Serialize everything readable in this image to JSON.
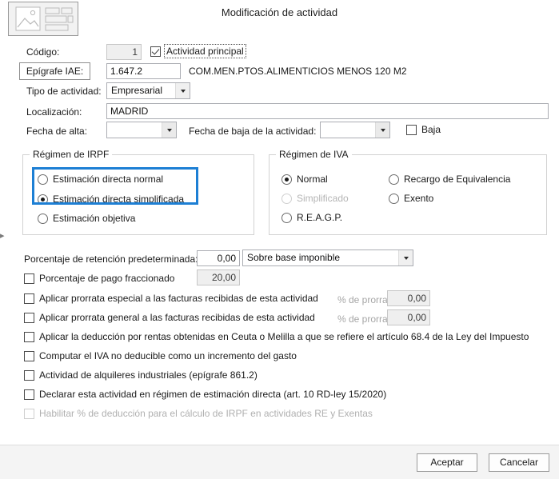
{
  "dialog": {
    "title": "Modificación de actividad",
    "icon": "image-placeholder-icon"
  },
  "form": {
    "codigo_label": "Código:",
    "codigo_value": "1",
    "actividad_principal_label": "Actividad principal",
    "actividad_principal_checked": true,
    "epigrafe_button": "Epígrafe IAE:",
    "epigrafe_value": "1.647.2",
    "epigrafe_description": "COM.MEN.PTOS.ALIMENTICIOS MENOS 120 M2",
    "tipo_actividad_label": "Tipo de actividad:",
    "tipo_actividad_value": "Empresarial",
    "localizacion_label": "Localización:",
    "localizacion_value": "MADRID",
    "fecha_alta_label": "Fecha de alta:",
    "fecha_alta_value": "",
    "fecha_baja_label": "Fecha de baja de la actividad:",
    "fecha_baja_value": "",
    "baja_label": "Baja",
    "baja_checked": false
  },
  "irpf": {
    "title": "Régimen de IRPF",
    "options": [
      {
        "label": "Estimación directa normal",
        "selected": false
      },
      {
        "label": "Estimación directa simplificada",
        "selected": true
      },
      {
        "label": "Estimación objetiva",
        "selected": false
      }
    ],
    "highlight_color": "#1d7fd4"
  },
  "iva": {
    "title": "Régimen de IVA",
    "options_left": [
      {
        "label": "Normal",
        "selected": true,
        "disabled": false
      },
      {
        "label": "Simplificado",
        "selected": false,
        "disabled": true
      },
      {
        "label": "R.E.A.G.P.",
        "selected": false,
        "disabled": false
      }
    ],
    "options_right": [
      {
        "label": "Recargo de Equivalencia",
        "selected": false,
        "disabled": false
      },
      {
        "label": "Exento",
        "selected": false,
        "disabled": false
      }
    ]
  },
  "retencion": {
    "label": "Porcentaje de retención predeterminada:",
    "value": "0,00",
    "base_option": "Sobre base imponible"
  },
  "pago_fraccionado": {
    "label": "Porcentaje de pago fraccionado",
    "checked": false,
    "value": "20,00"
  },
  "prorrata": {
    "percent_label": "% de prorrata:",
    "rows": [
      {
        "label": "Aplicar prorrata especial a las facturas recibidas de esta actividad",
        "checked": false,
        "value": "0,00"
      },
      {
        "label": "Aplicar prorrata general a las facturas recibidas de esta actividad",
        "checked": false,
        "value": "0,00"
      }
    ]
  },
  "checkboxes": [
    {
      "label": "Aplicar la deducción por rentas obtenidas en Ceuta o Melilla a que se refiere el artículo 68.4 de la Ley del Impuesto",
      "checked": false,
      "disabled": false
    },
    {
      "label": "Computar el IVA no deducible como un incremento del gasto",
      "checked": false,
      "disabled": false
    },
    {
      "label": "Actividad de alquileres industriales (epígrafe 861.2)",
      "checked": false,
      "disabled": false
    },
    {
      "label": "Declarar esta actividad en régimen de estimación directa (art. 10 RD-ley 15/2020)",
      "checked": false,
      "disabled": false
    },
    {
      "label": "Habilitar % de deducción para el cálculo de IRPF en actividades RE y Exentas",
      "checked": false,
      "disabled": true
    }
  ],
  "footer": {
    "accept_label": "Aceptar",
    "cancel_label": "Cancelar"
  }
}
